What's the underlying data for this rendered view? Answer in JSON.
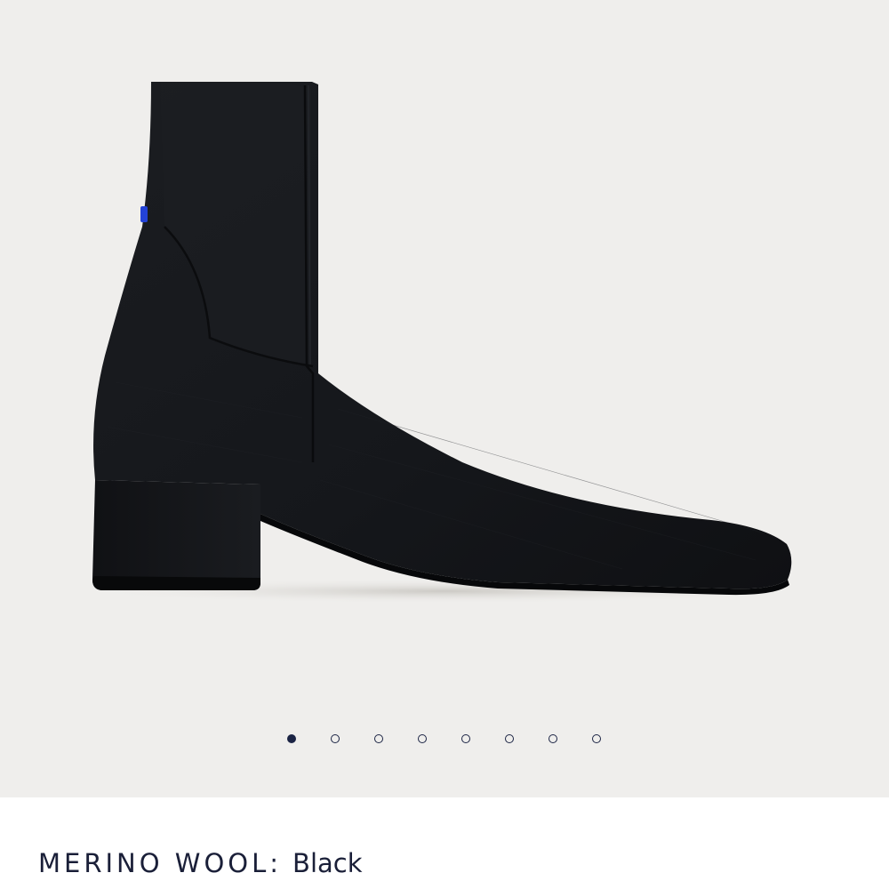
{
  "gallery": {
    "image_subject": "black knit ankle boot with block heel",
    "accent_color": "#2342d6",
    "boot_color": "#141619",
    "background_color": "#efeeec",
    "dot_count": 8,
    "active_dot_index": 0,
    "dot_color": "#1b2444"
  },
  "product": {
    "material_label": "MERINO WOOL:",
    "color_value": "Black"
  }
}
